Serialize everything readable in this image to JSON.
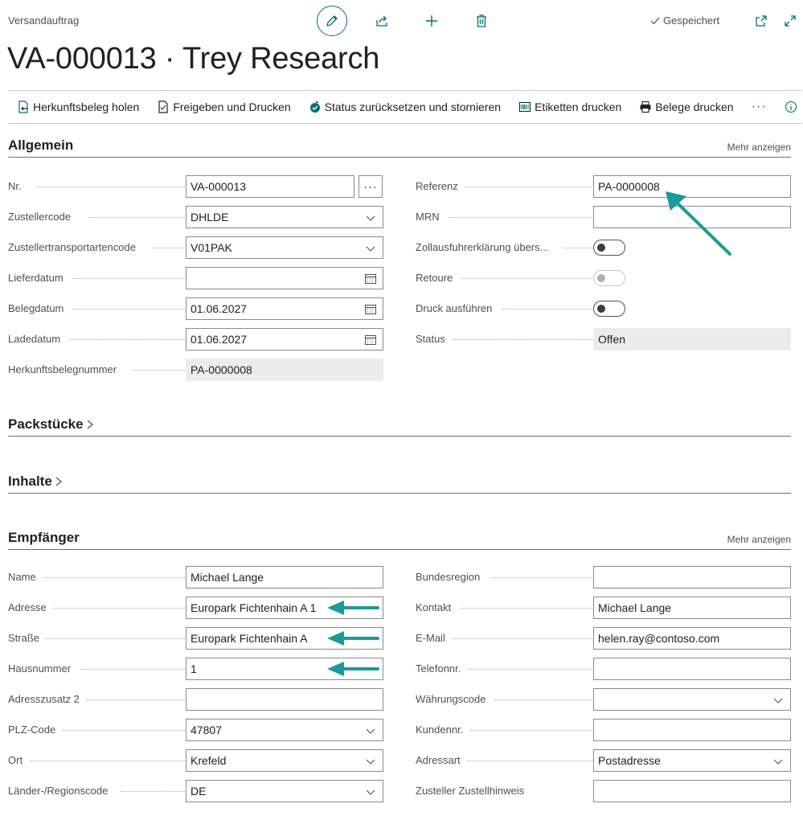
{
  "header": {
    "entity": "Versandauftrag",
    "title": "VA-000013 · Trey Research",
    "saved": "Gespeichert"
  },
  "actions": [
    {
      "label": "Herkunftsbeleg holen",
      "icon": "get-document-icon"
    },
    {
      "label": "Freigeben und Drucken",
      "icon": "release-print-icon"
    },
    {
      "label": "Status zurücksetzen und stornieren",
      "icon": "reset-status-icon"
    },
    {
      "label": "Etiketten drucken",
      "icon": "barcode-icon"
    },
    {
      "label": "Belege drucken",
      "icon": "printer-icon"
    }
  ],
  "more_actions": "···",
  "allgemein": {
    "title": "Allgemein",
    "more": "Mehr anzeigen",
    "left": [
      {
        "label": "Nr.",
        "value": "VA-000013"
      },
      {
        "label": "Zustellercode",
        "value": "DHLDE"
      },
      {
        "label": "Zustellertransportartencode",
        "value": "V01PAK"
      },
      {
        "label": "Lieferdatum",
        "value": ""
      },
      {
        "label": "Belegdatum",
        "value": "01.06.2027"
      },
      {
        "label": "Ladedatum",
        "value": "01.06.2027"
      },
      {
        "label": "Herkunftsbelegnummer",
        "value": "PA-0000008"
      }
    ],
    "right": [
      {
        "label": "Referenz",
        "value": "PA-0000008"
      },
      {
        "label": "MRN",
        "value": ""
      },
      {
        "label": "Zollausfuhrerklärung übers...",
        "value": "off"
      },
      {
        "label": "Retoure",
        "value": "off"
      },
      {
        "label": "Druck ausführen",
        "value": "off"
      },
      {
        "label": "Status",
        "value": "Offen"
      }
    ]
  },
  "packstuecke": {
    "title": "Packstücke"
  },
  "inhalte": {
    "title": "Inhalte"
  },
  "empfaenger": {
    "title": "Empfänger",
    "more": "Mehr anzeigen",
    "left": [
      {
        "label": "Name",
        "value": "Michael Lange"
      },
      {
        "label": "Adresse",
        "value": "Europark Fichtenhain A 1"
      },
      {
        "label": "Straße",
        "value": "Europark Fichtenhain A"
      },
      {
        "label": "Hausnummer",
        "value": "1"
      },
      {
        "label": "Adresszusatz 2",
        "value": ""
      },
      {
        "label": "PLZ-Code",
        "value": "47807"
      },
      {
        "label": "Ort",
        "value": "Krefeld"
      },
      {
        "label": "Länder-/Regionscode",
        "value": "DE"
      }
    ],
    "right": [
      {
        "label": "Bundesregion",
        "value": ""
      },
      {
        "label": "Kontakt",
        "value": "Michael Lange"
      },
      {
        "label": "E-Mail",
        "value": "helen.ray@contoso.com"
      },
      {
        "label": "Telefonnr.",
        "value": ""
      },
      {
        "label": "Währungscode",
        "value": ""
      },
      {
        "label": "Kundennr.",
        "value": ""
      },
      {
        "label": "Adressart",
        "value": "Postadresse"
      },
      {
        "label": "Zusteller Zustellhinweis",
        "value": ""
      }
    ]
  },
  "colors": {
    "accent": "#00706f",
    "annotation_arrow": "#1a9a9a"
  }
}
